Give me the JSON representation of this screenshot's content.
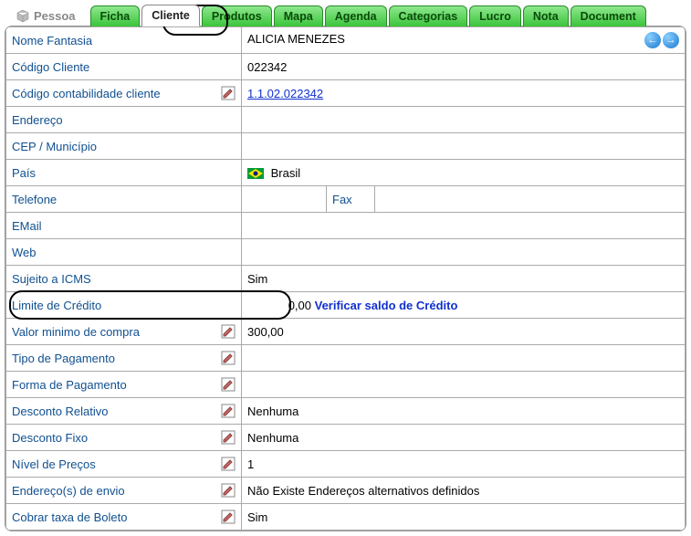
{
  "header": {
    "pessoa": "Pessoa",
    "tabs": [
      "Ficha",
      "Cliente",
      "Produtos",
      "Mapa",
      "Agenda",
      "Categorias",
      "Lucro",
      "Nota",
      "Document"
    ],
    "active_tab": "Cliente"
  },
  "fields": {
    "nome_fantasia": {
      "label": "Nome Fantasia",
      "value": "ALICIA MENEZES"
    },
    "codigo_cliente": {
      "label": "Código Cliente",
      "value": "022342"
    },
    "codigo_contab": {
      "label": "Código contabilidade cliente",
      "value": "1.1.02.022342"
    },
    "endereco": {
      "label": "Endereço",
      "value": ""
    },
    "cep_municipio": {
      "label": "CEP / Município",
      "value": ""
    },
    "pais": {
      "label": "País",
      "value": "Brasil"
    },
    "telefone": {
      "label": "Telefone",
      "value": ""
    },
    "fax": {
      "label": "Fax",
      "value": ""
    },
    "email": {
      "label": "EMail",
      "value": ""
    },
    "web": {
      "label": "Web",
      "value": ""
    },
    "sujeito_icms": {
      "label": "Sujeito a ICMS",
      "value": "Sim"
    },
    "limite_credito": {
      "label": "Limite de Crédito",
      "value": "0,00",
      "action": "Verificar saldo de Crédito"
    },
    "valor_minimo": {
      "label": "Valor minimo de compra",
      "value": "300,00"
    },
    "tipo_pagamento": {
      "label": "Tipo de Pagamento",
      "value": ""
    },
    "forma_pagamento": {
      "label": "Forma de Pagamento",
      "value": ""
    },
    "desconto_relativo": {
      "label": "Desconto Relativo",
      "value": "Nenhuma"
    },
    "desconto_fixo": {
      "label": "Desconto Fixo",
      "value": "Nenhuma"
    },
    "nivel_precos": {
      "label": "Nível de Preços",
      "value": "1"
    },
    "enderecos_envio": {
      "label": "Endereço(s) de envio",
      "value": "Não Existe Endereços alternativos definidos"
    },
    "cobrar_boleto": {
      "label": "Cobrar taxa de Boleto",
      "value": "Sim"
    }
  }
}
